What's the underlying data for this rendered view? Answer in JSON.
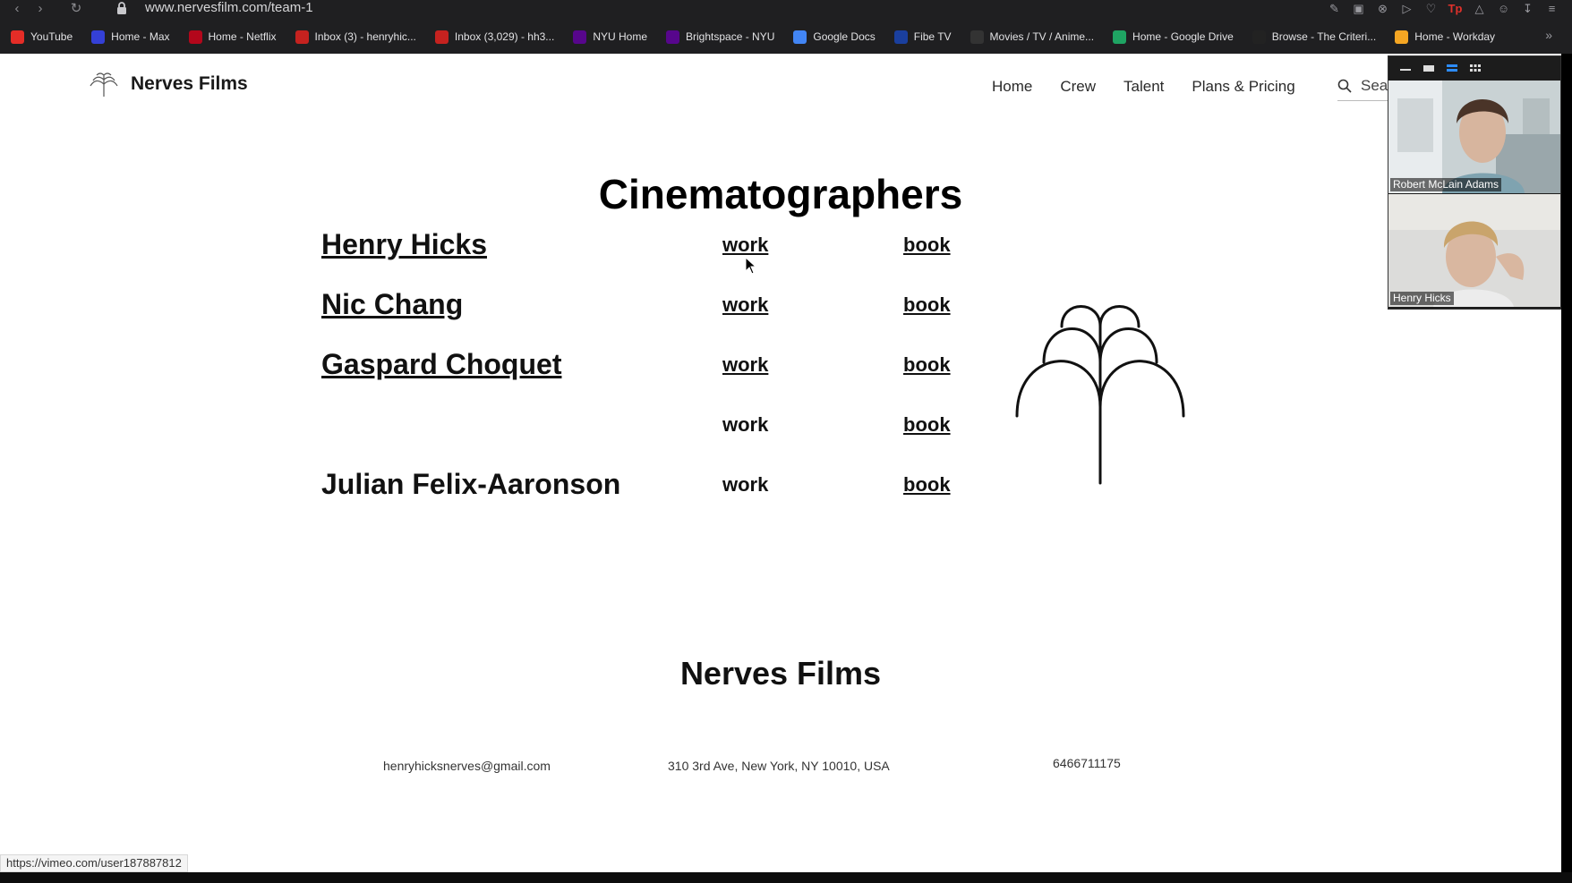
{
  "browser": {
    "url": "www.nervesfilm.com/team-1",
    "bookmarks": [
      {
        "label": "YouTube",
        "icon": "youtube-icon",
        "color": "#e52d27"
      },
      {
        "label": "Home - Max",
        "icon": "max-icon",
        "color": "#3440d6"
      },
      {
        "label": "Home - Netflix",
        "icon": "netflix-icon",
        "color": "#b3071b"
      },
      {
        "label": "Inbox (3) - henryhic...",
        "icon": "gmail-icon",
        "color": "#c5221f"
      },
      {
        "label": "Inbox (3,029) - hh3...",
        "icon": "gmail-icon",
        "color": "#c5221f"
      },
      {
        "label": "NYU Home",
        "icon": "nyu-icon",
        "color": "#57068c"
      },
      {
        "label": "Brightspace - NYU",
        "icon": "nyu-icon",
        "color": "#57068c"
      },
      {
        "label": "Google Docs",
        "icon": "docs-icon",
        "color": "#4285f4"
      },
      {
        "label": "Fibe TV",
        "icon": "fibe-icon",
        "color": "#1a3f9e"
      },
      {
        "label": "Movies / TV / Anime...",
        "icon": "play-icon",
        "color": "#333333"
      },
      {
        "label": "Home - Google Drive",
        "icon": "drive-icon",
        "color": "#1fa463"
      },
      {
        "label": "Browse - The Criteri...",
        "icon": "criterion-icon",
        "color": "#222222"
      },
      {
        "label": "Home - Workday",
        "icon": "workday-icon",
        "color": "#f5a623"
      }
    ],
    "status_url": "https://vimeo.com/user187887812"
  },
  "site": {
    "brand": "Nerves Films",
    "nav": [
      "Home",
      "Crew",
      "Talent",
      "Plans & Pricing"
    ],
    "search_placeholder": "Sear"
  },
  "main": {
    "heading": "Cinematographers",
    "members": [
      {
        "name": "Henry Hicks",
        "name_link": true,
        "work": "work",
        "work_link": true,
        "book": "book"
      },
      {
        "name": "Nic Chang",
        "name_link": true,
        "work": "work",
        "work_link": true,
        "book": "book"
      },
      {
        "name": "Gaspard Choquet",
        "name_link": true,
        "work": "work",
        "work_link": true,
        "book": "book"
      },
      {
        "name": "",
        "name_link": false,
        "work": "work",
        "work_link": false,
        "book": "book"
      },
      {
        "name": "Julian Felix-Aaronson",
        "name_link": false,
        "work": "work",
        "work_link": false,
        "book": "book"
      }
    ]
  },
  "footer": {
    "brand": "Nerves Films",
    "email": "henryhicksnerves@gmail.com",
    "address": "310 3rd Ave, New York, NY 10010, USA",
    "phone": "6466711175"
  },
  "video_call": {
    "participants": [
      "Robert McLain Adams",
      "Henry Hicks"
    ]
  }
}
